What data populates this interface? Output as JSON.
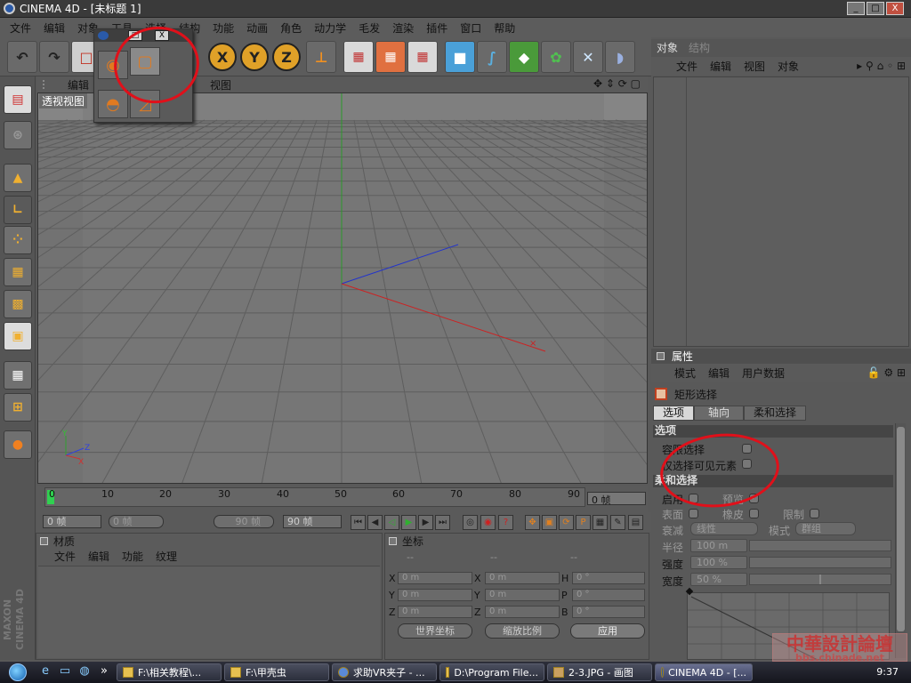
{
  "window": {
    "title": "CINEMA 4D - [未标题 1]",
    "min": "_",
    "max": "□",
    "close": "X"
  },
  "menubar": [
    "文件",
    "编辑",
    "对象",
    "工具",
    "选择",
    "结构",
    "功能",
    "动画",
    "角色",
    "动力学",
    "毛发",
    "渲染",
    "插件",
    "窗口",
    "帮助"
  ],
  "toolbar": {
    "axis_x": "X",
    "axis_y": "Y",
    "axis_z": "Z"
  },
  "popup": {
    "min": "□",
    "close": "X"
  },
  "viewport": {
    "menus": [
      "编辑",
      "视图"
    ],
    "label": "透视视图"
  },
  "axis_gizmo": {
    "x": "X",
    "y": "Y",
    "z": "Z"
  },
  "timeline": {
    "ticks": [
      "0",
      "10",
      "20",
      "30",
      "40",
      "50",
      "60",
      "70",
      "80",
      "90"
    ],
    "frame": "0 帧",
    "start": "0 帧",
    "range_start": "0 帧",
    "range_end": "90 帧",
    "end": "90 帧"
  },
  "materials": {
    "title": "材质",
    "menu": [
      "文件",
      "编辑",
      "功能",
      "纹理"
    ]
  },
  "coords": {
    "title": "坐标",
    "headers": [
      "--",
      "--",
      "--"
    ],
    "rows": [
      {
        "a": "X",
        "av": "0 m",
        "b": "X",
        "bv": "0 m",
        "c": "H",
        "cv": "0 °"
      },
      {
        "a": "Y",
        "av": "0 m",
        "b": "Y",
        "bv": "0 m",
        "c": "P",
        "cv": "0 °"
      },
      {
        "a": "Z",
        "av": "0 m",
        "b": "Z",
        "bv": "0 m",
        "c": "B",
        "cv": "0 °"
      }
    ],
    "world": "世界坐标",
    "scale": "缩放比例",
    "apply": "应用"
  },
  "objects": {
    "tabs": [
      "对象",
      "结构"
    ],
    "menu": [
      "文件",
      "编辑",
      "视图",
      "对象"
    ]
  },
  "attributes": {
    "title": "属性",
    "menu": [
      "模式",
      "编辑",
      "用户数据"
    ],
    "tool": "矩形选择",
    "tabs": [
      "选项",
      "轴向",
      "柔和选择"
    ],
    "sec_options": "选项",
    "tolerant": "容限选择",
    "visible_only": "仅选择可见元素",
    "sec_soft": "柔和选择",
    "enable": "启用",
    "preview": "预览",
    "surface": "表面",
    "rubber": "橡皮",
    "restrict": "限制",
    "falloff": "衰减",
    "falloff_val": "线性",
    "mode": "模式",
    "mode_val": "群组",
    "radius": "半径",
    "radius_val": "100 m",
    "strength": "强度",
    "strength_val": "100 %",
    "width": "宽度",
    "width_val": "50 %"
  },
  "left_logo": "MAXON CINEMA 4D",
  "watermark": {
    "line1": "中華設計論壇",
    "line2": "bbs.chinade.net"
  },
  "taskbar": {
    "tasks": [
      "F:\\相关教程\\...",
      "F:\\甲壳虫",
      "求助VR夹子 - ...",
      "D:\\Program File...",
      "2-3.JPG - 画图",
      "CINEMA 4D - [..."
    ],
    "clock": "9:37"
  }
}
